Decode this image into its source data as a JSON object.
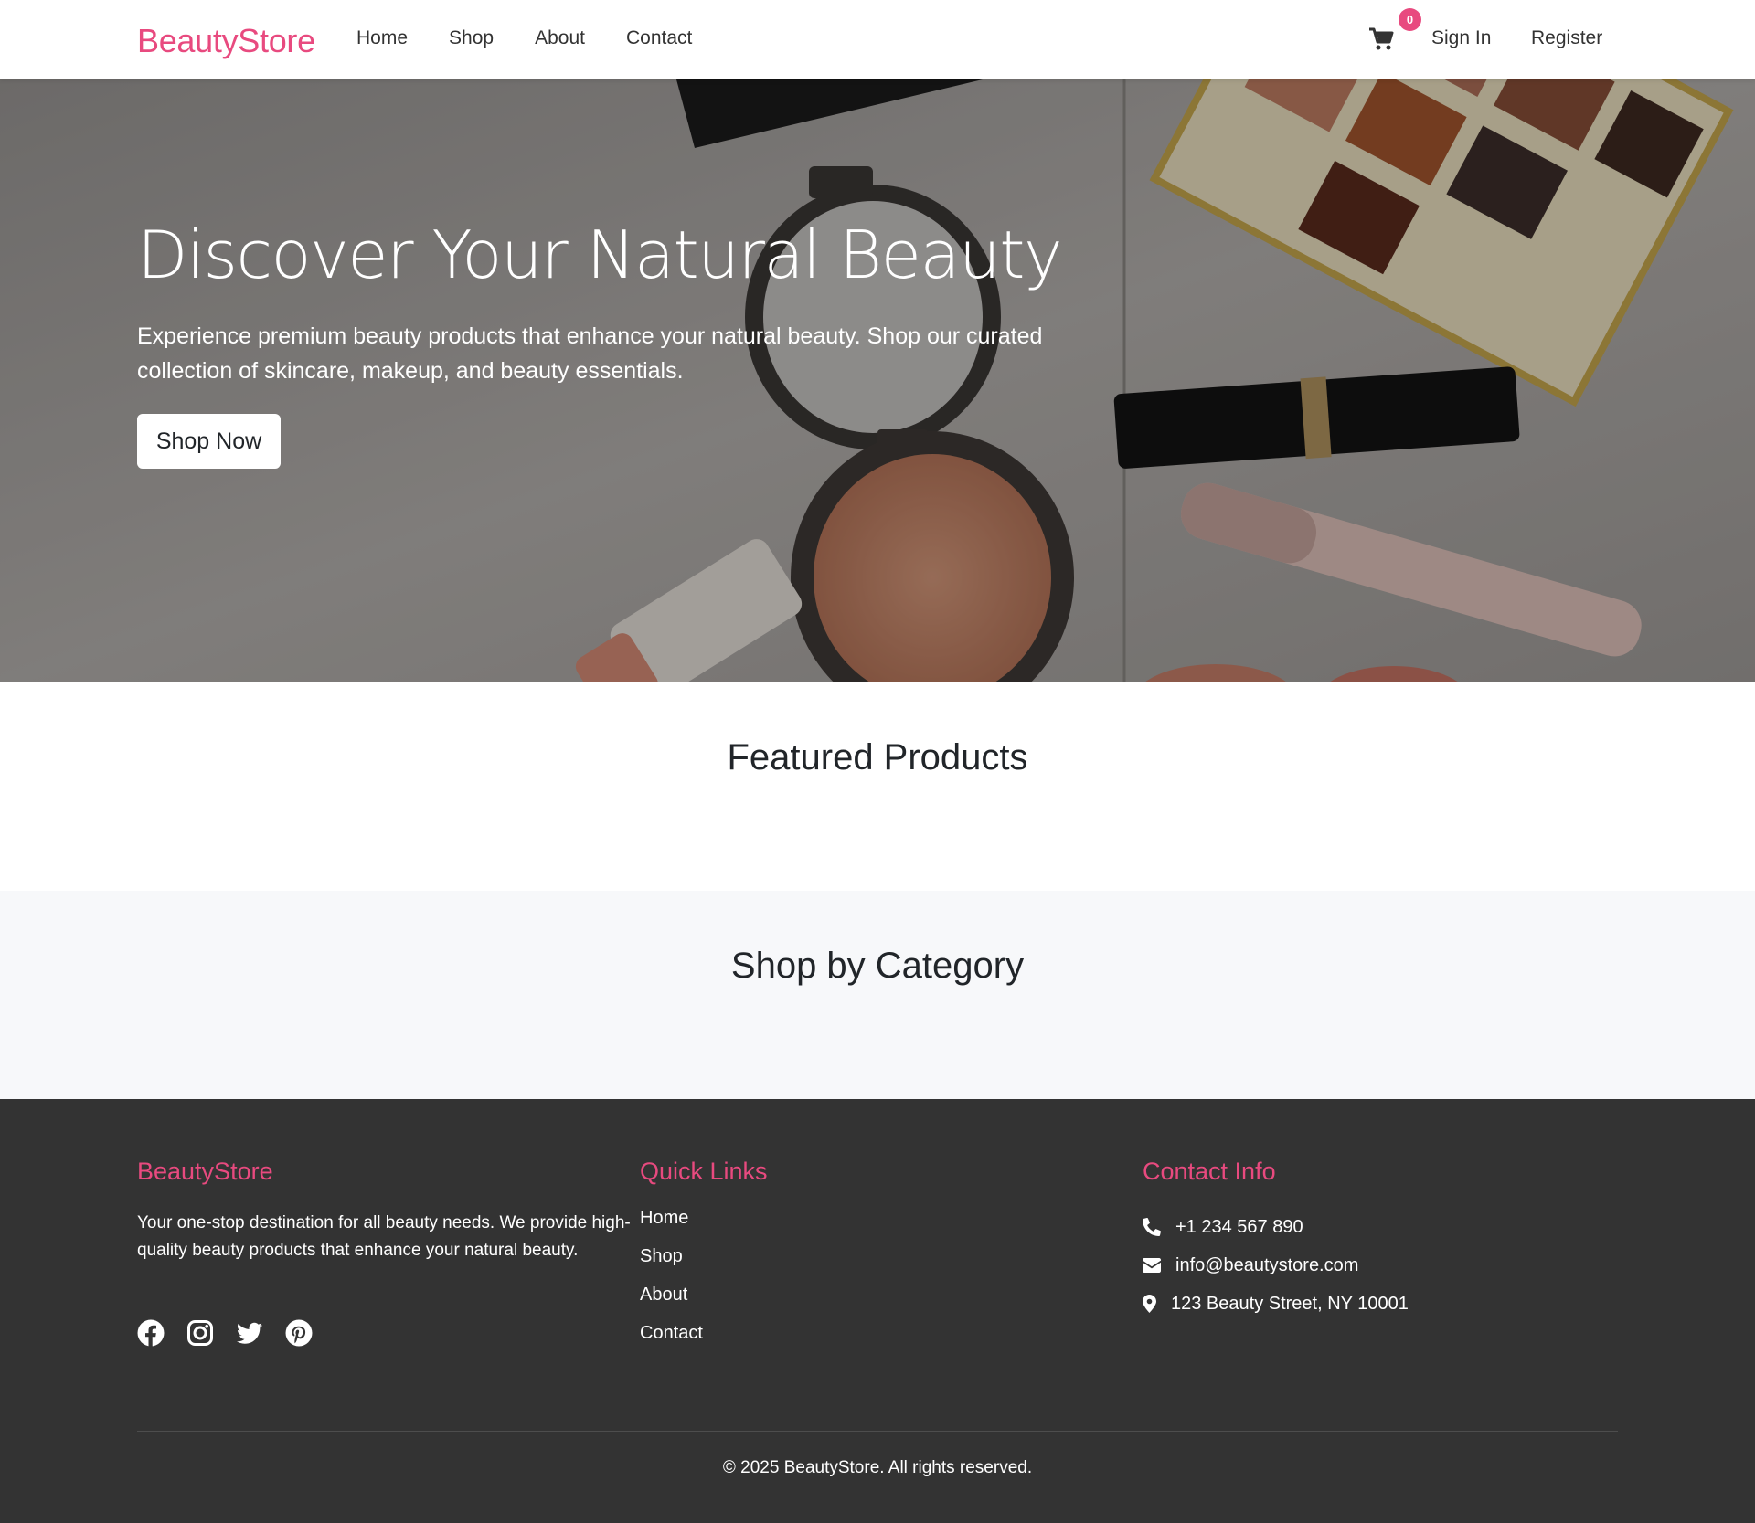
{
  "navbar": {
    "brand": "BeautyStore",
    "links": [
      "Home",
      "Shop",
      "About",
      "Contact"
    ],
    "cart_count": "0",
    "sign_in": "Sign In",
    "register": "Register",
    "cart_icon": "shopping-cart-icon"
  },
  "hero": {
    "title": "Discover Your Natural Beauty",
    "subtitle": "Experience premium beauty products that enhance your natural beauty. Shop our curated collection of skincare, makeup, and beauty essentials.",
    "cta": "Shop Now"
  },
  "featured": {
    "title": "Featured Products"
  },
  "category": {
    "title": "Shop by Category"
  },
  "footer": {
    "about": {
      "heading": "BeautyStore",
      "text": "Your one-stop destination for all beauty needs. We provide high-quality beauty products that enhance your natural beauty.",
      "socials": [
        "facebook-icon",
        "instagram-icon",
        "twitter-icon",
        "pinterest-icon"
      ]
    },
    "quick_links": {
      "heading": "Quick Links",
      "items": [
        "Home",
        "Shop",
        "About",
        "Contact"
      ]
    },
    "contact": {
      "heading": "Contact Info",
      "phone": "+1 234 567 890",
      "email": "info@beautystore.com",
      "address": "123 Beauty Street, NY 10001"
    },
    "copyright": "© 2025 BeautyStore. All rights reserved."
  },
  "colors": {
    "accent": "#e84a7f",
    "footer_bg": "#333333",
    "category_bg": "#f7f8fa"
  }
}
